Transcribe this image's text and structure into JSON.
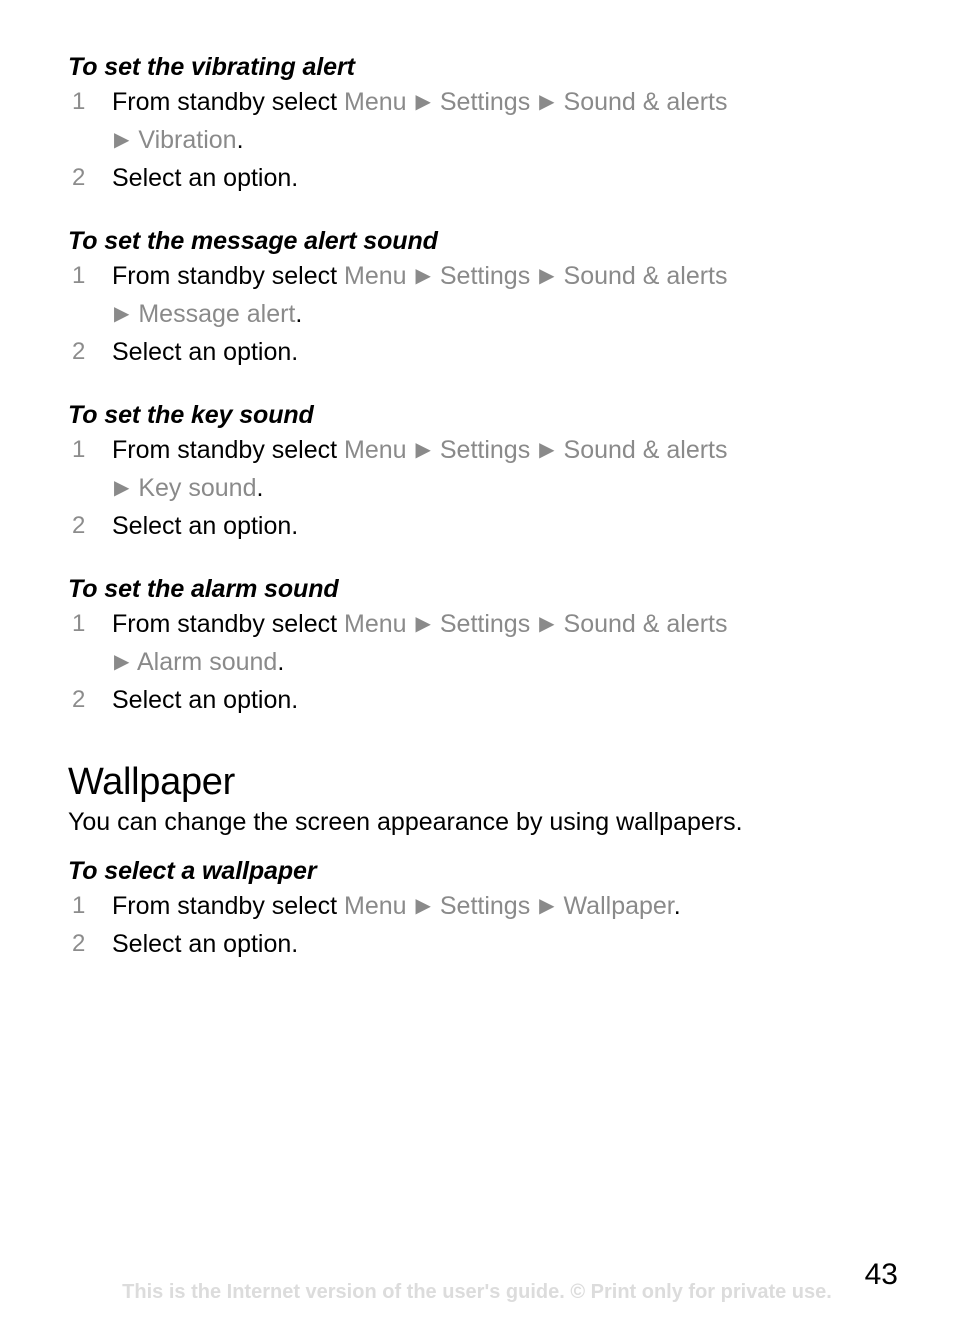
{
  "document": {
    "page_number": "43",
    "footer_text": "This is the Internet version of the user's guide. © Print only for private use.",
    "separator_glyph": "▶"
  },
  "sections": [
    {
      "heading": "To set the vibrating alert",
      "steps": [
        {
          "number": "1",
          "lead": "From standby select ",
          "path": [
            "Menu",
            "Settings",
            "Sound & alerts"
          ],
          "path_cont": [
            "Vibration"
          ],
          "terminator": "."
        },
        {
          "number": "2",
          "lead": "Select an option.",
          "path": [],
          "path_cont": [],
          "terminator": ""
        }
      ]
    },
    {
      "heading": "To set the message alert sound",
      "steps": [
        {
          "number": "1",
          "lead": "From standby select ",
          "path": [
            "Menu",
            "Settings",
            "Sound & alerts"
          ],
          "path_cont": [
            "Message alert"
          ],
          "terminator": "."
        },
        {
          "number": "2",
          "lead": "Select an option.",
          "path": [],
          "path_cont": [],
          "terminator": ""
        }
      ]
    },
    {
      "heading": "To set the key sound",
      "steps": [
        {
          "number": "1",
          "lead": "From standby select ",
          "path": [
            "Menu",
            "Settings",
            "Sound & alerts"
          ],
          "path_cont": [
            "Key sound"
          ],
          "terminator": "."
        },
        {
          "number": "2",
          "lead": "Select an option.",
          "path": [],
          "path_cont": [],
          "terminator": ""
        }
      ]
    },
    {
      "heading": "To set the alarm sound",
      "steps": [
        {
          "number": "1",
          "lead": "From standby select ",
          "path": [
            "Menu",
            "Settings",
            "Sound & alerts"
          ],
          "path_cont": [
            "Alarm sound"
          ],
          "terminator": "."
        },
        {
          "number": "2",
          "lead": "Select an option.",
          "path": [],
          "path_cont": [],
          "terminator": ""
        }
      ]
    }
  ],
  "wallpaper": {
    "title": "Wallpaper",
    "intro": "You can change the screen appearance by using wallpapers.",
    "heading": "To select a wallpaper",
    "steps": [
      {
        "number": "1",
        "lead": "From standby select ",
        "path": [
          "Menu",
          "Settings",
          "Wallpaper"
        ],
        "path_cont": [],
        "terminator": "."
      },
      {
        "number": "2",
        "lead": "Select an option.",
        "path": [],
        "path_cont": [],
        "terminator": ""
      }
    ]
  }
}
